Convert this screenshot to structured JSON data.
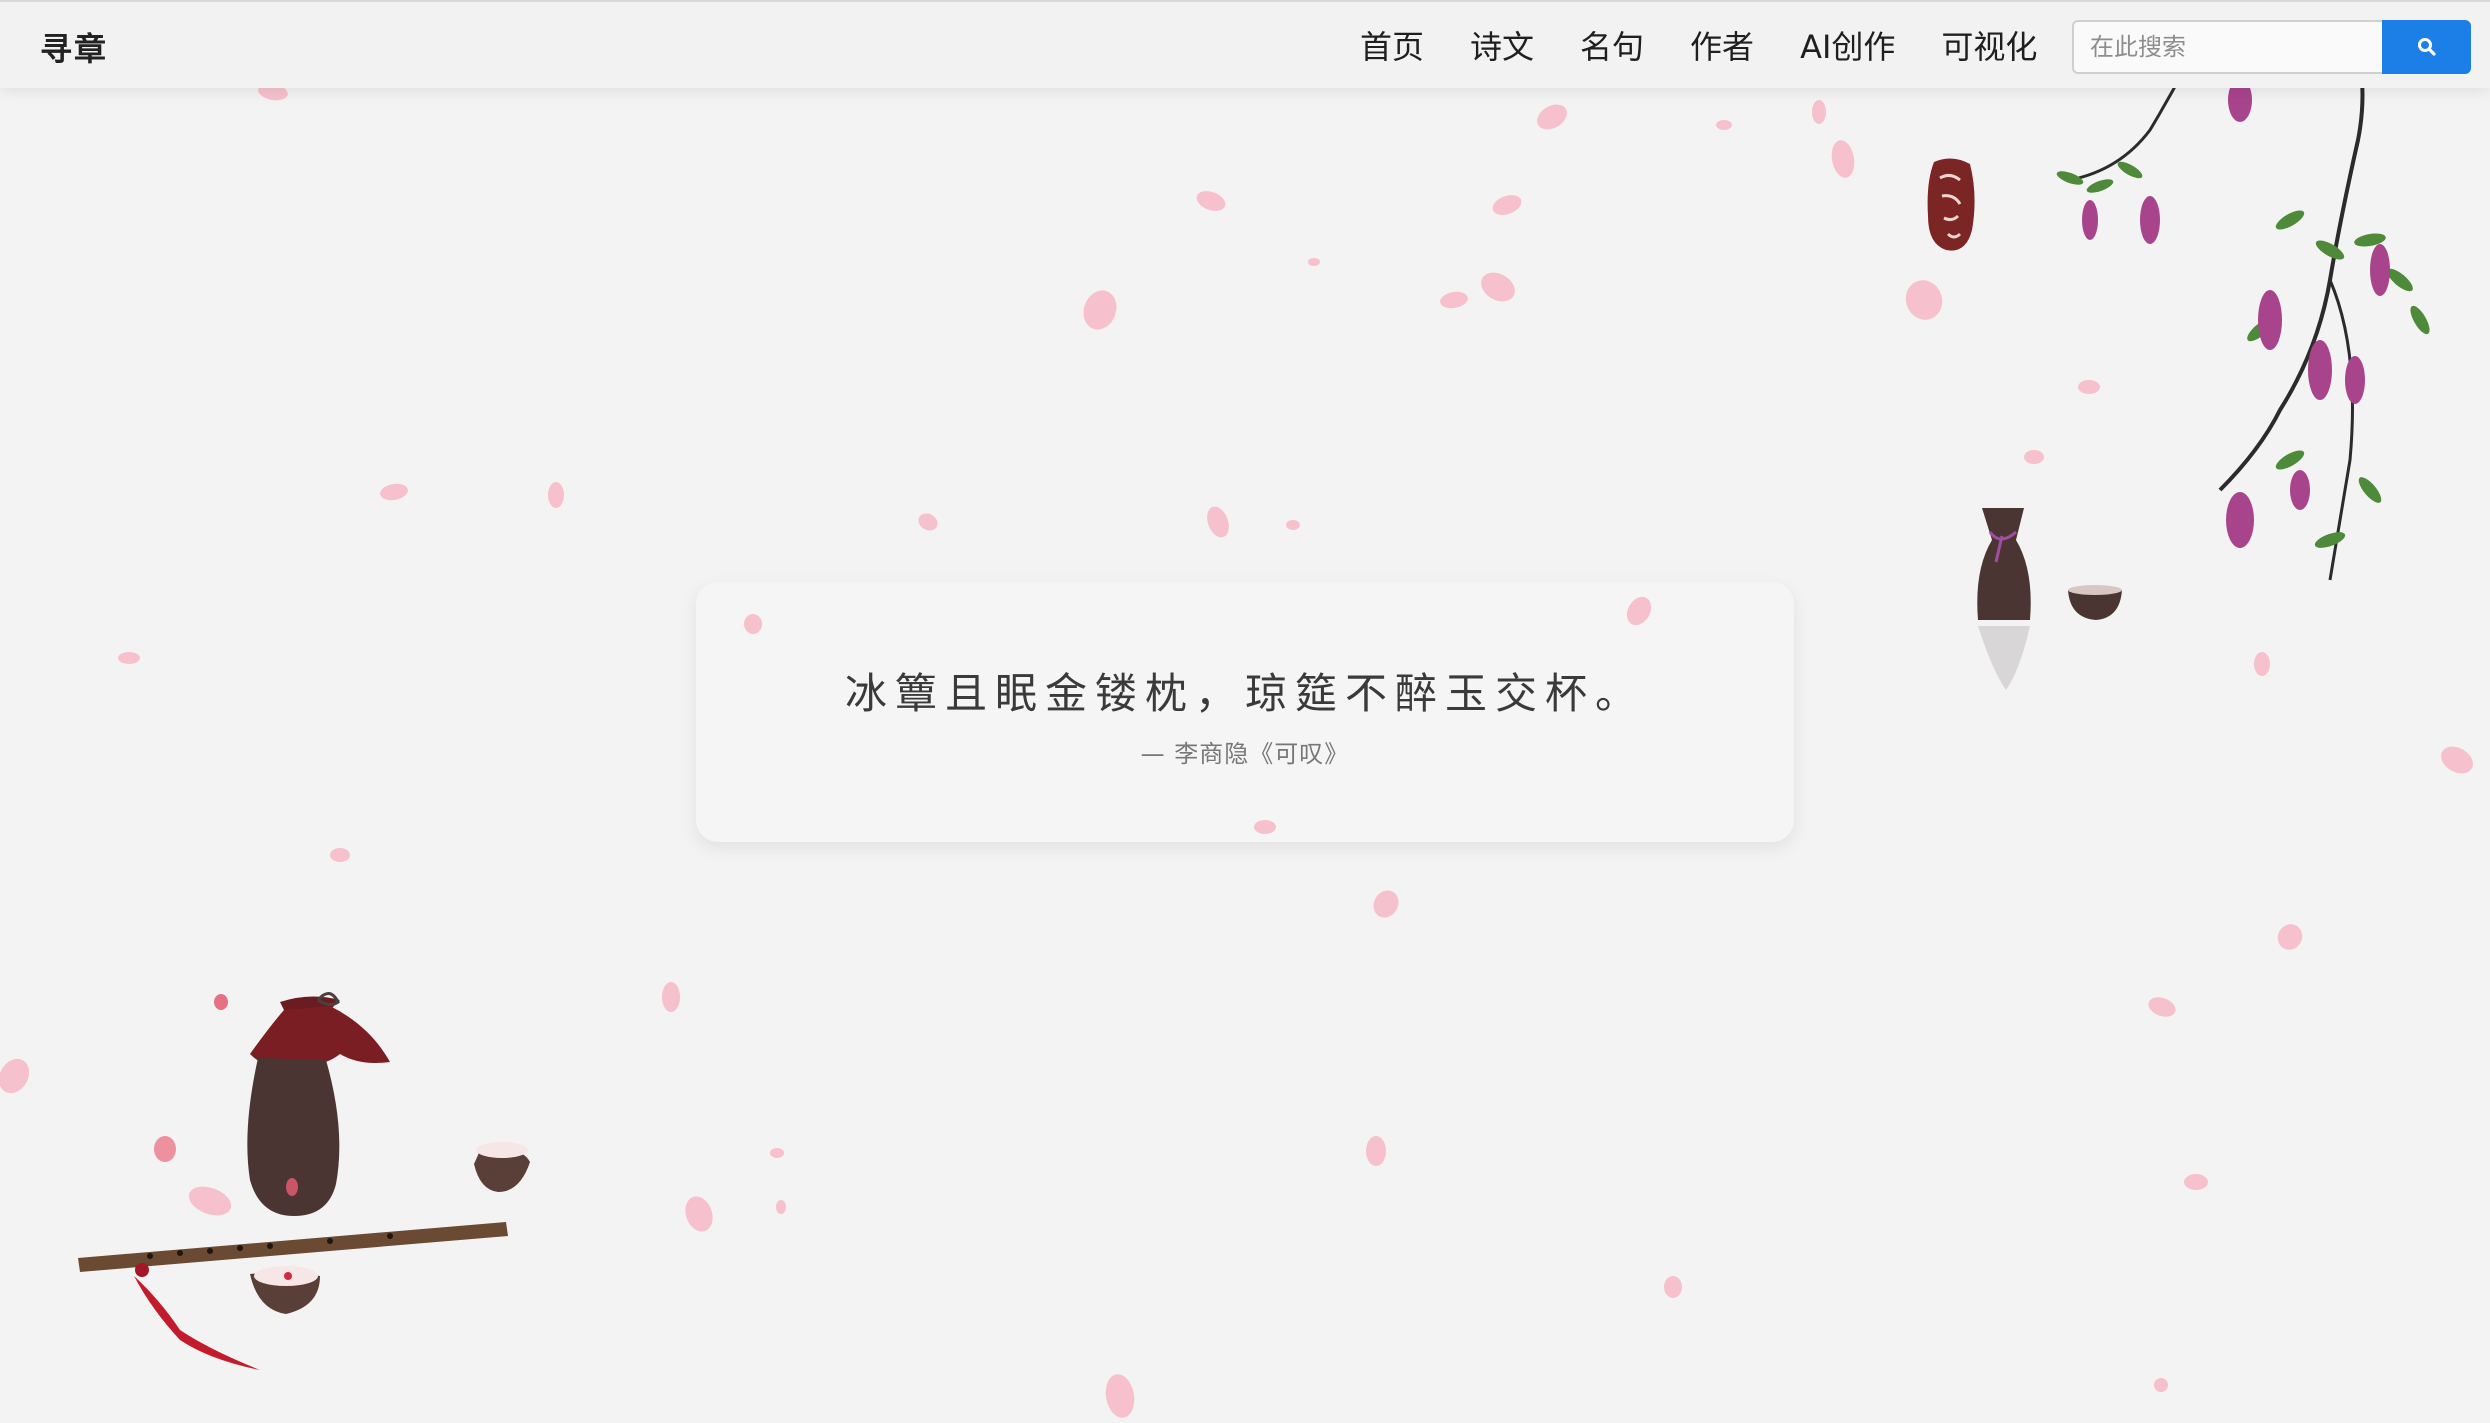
{
  "brand": {
    "title": "寻章"
  },
  "nav": {
    "items": [
      {
        "label": "首页"
      },
      {
        "label": "诗文"
      },
      {
        "label": "名句"
      },
      {
        "label": "作者"
      },
      {
        "label": "AI创作"
      },
      {
        "label": "可视化"
      }
    ]
  },
  "search": {
    "placeholder": "在此搜索",
    "value": ""
  },
  "quote": {
    "text": "冰簟且眠金镂枕，琼筵不醉玉交杯。",
    "source": "— 李商隐《可叹》"
  },
  "colors": {
    "accent": "#1c7fe8",
    "petal": "#f6b7c6",
    "wisteria": "#a8448c",
    "leaf": "#4f8a3a",
    "wine_jar": "#4a3532",
    "cloth": "#7a1e24"
  },
  "decorations": {
    "seal_icon": "red-seal-stamp",
    "branch_icon": "wisteria-branch",
    "vase_icon": "wine-vase-and-cup",
    "jar_icon": "wine-jar-with-flute"
  }
}
